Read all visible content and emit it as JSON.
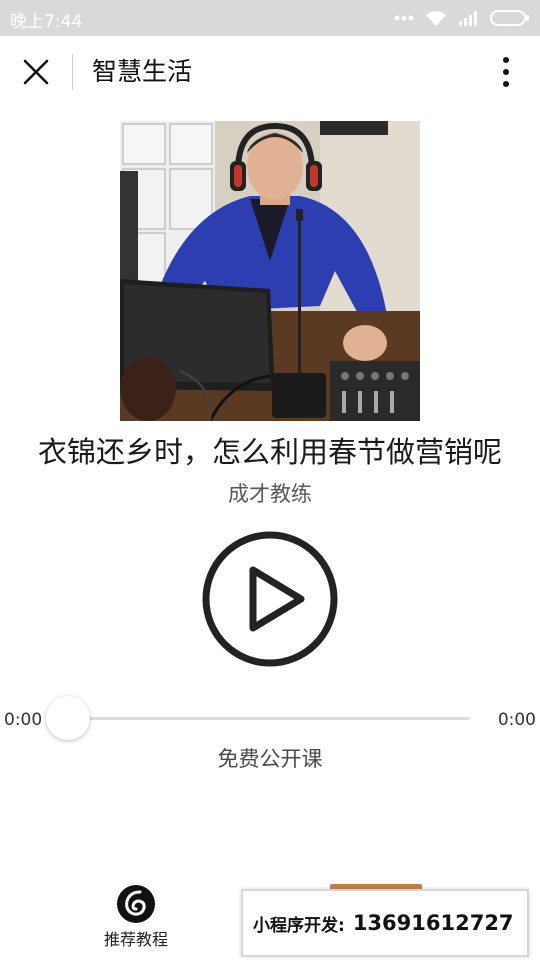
{
  "status_bar": {
    "time": "晚上7:44",
    "icons": [
      "signal-dots-icon",
      "wifi-icon",
      "cellular-signal-icon",
      "battery-icon"
    ]
  },
  "nav": {
    "title": "智慧生活",
    "close_icon": "close-icon",
    "more_icon": "more-vertical-icon"
  },
  "player": {
    "title": "衣锦还乡时，怎么利用春节做营销呢",
    "author": "成才教练",
    "current_time": "0:00",
    "total_time": "0:00",
    "progress": 0,
    "category": "免费公开课",
    "play_icon": "play-icon"
  },
  "bottom": {
    "tab_label": "推荐教程",
    "tab_icon": "netease-music-icon",
    "promo_label": "小程序开发:",
    "promo_phone": "13691612727"
  },
  "colors": {
    "status_bar_bg": "#d9d9d9",
    "play_ring": "#222222",
    "progress_track": "#dddddd"
  }
}
